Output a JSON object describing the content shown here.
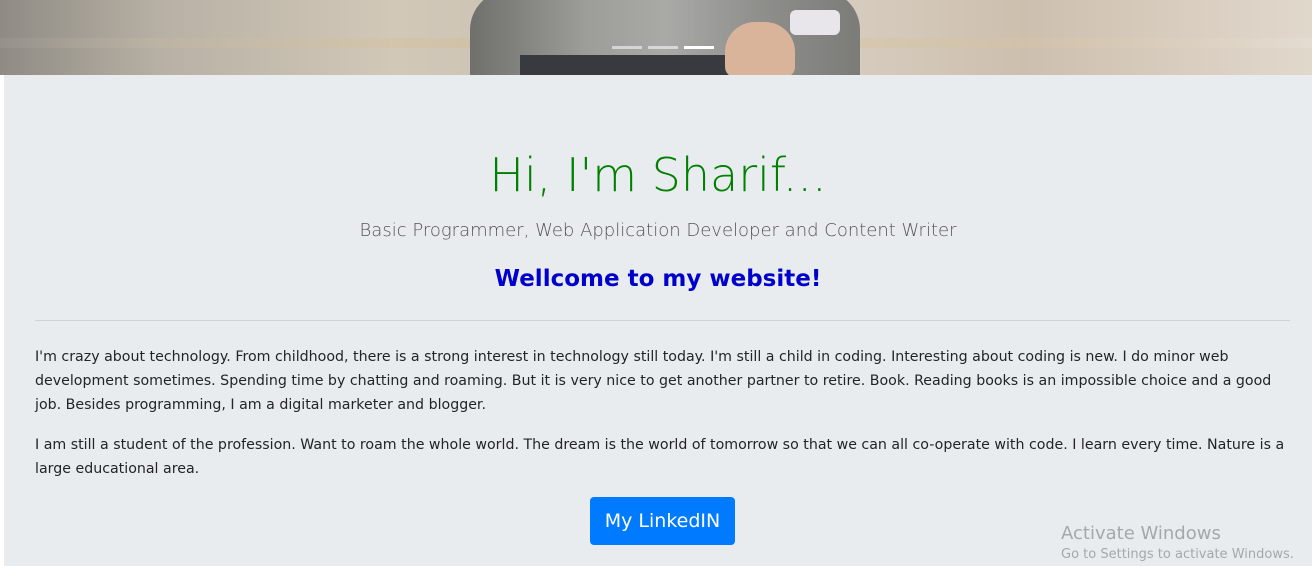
{
  "hero": {
    "carousel_indicators": [
      {
        "active": false
      },
      {
        "active": false
      },
      {
        "active": true
      }
    ]
  },
  "intro": {
    "title": "Hi, I'm Sharif...",
    "subtitle": "Basic Programmer, Web Application Developer and Content Writer",
    "welcome": "Wellcome to my website!",
    "paragraphs": [
      "I'm crazy about technology. From childhood, there is a strong interest in technology still today. I'm still a child in coding. Interesting about coding is new. I do minor web development sometimes. Spending time by chatting and roaming. But it is very nice to get another partner to retire. Book. Reading books is an impossible choice and a good job. Besides programming, I am a digital marketer and blogger.",
      "I am still a student of the profession. Want to roam the whole world. The dream is the world of tomorrow so that we can all co-operate with code. I learn every time. Nature is a large educational area."
    ],
    "linkedin_button": "My LinkedIN"
  },
  "watermark": {
    "title": "Activate Windows",
    "subtitle": "Go to Settings to activate Windows."
  },
  "colors": {
    "title": "#008000",
    "welcome": "#0000cd",
    "button": "#007bff",
    "jumbotron_bg": "#e9ecef"
  }
}
